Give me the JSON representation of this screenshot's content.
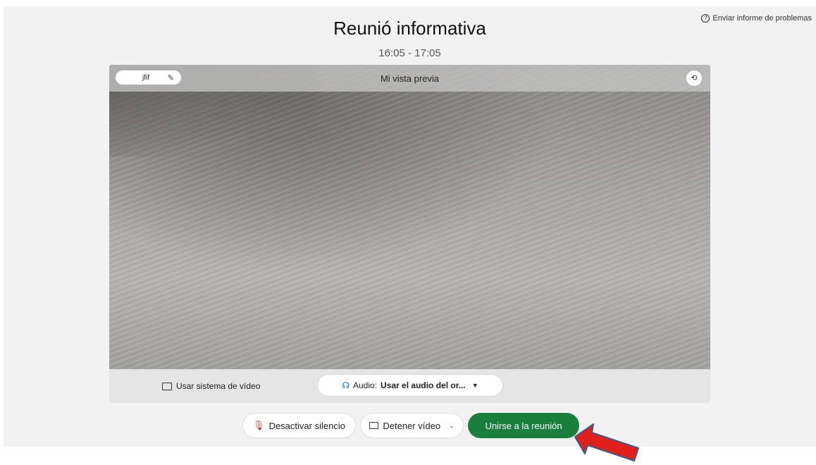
{
  "header": {
    "report_link": "Enviar informe de problemas",
    "title": "Reunió informativa",
    "time": "16:05 - 17:05"
  },
  "preview": {
    "name": "jfif",
    "label": "Mi vista previa",
    "use_video_system": "Usar sistema de vídeo",
    "audio_prefix": "Audio:",
    "audio_value": "Usar el audio del or..."
  },
  "controls": {
    "mute_label": "Desactivar silencio",
    "video_label": "Detener vídeo",
    "join_label": "Unirse a la reunión"
  },
  "colors": {
    "join_button": "#1a7f3c",
    "annotation_arrow": "#e0201b"
  },
  "icons": [
    "help-icon",
    "pencil-icon",
    "rotate-icon",
    "cast-icon",
    "headset-icon",
    "caret-down-icon",
    "mic-off-icon",
    "camera-icon",
    "chevron-down-icon",
    "arrow-annotation"
  ]
}
